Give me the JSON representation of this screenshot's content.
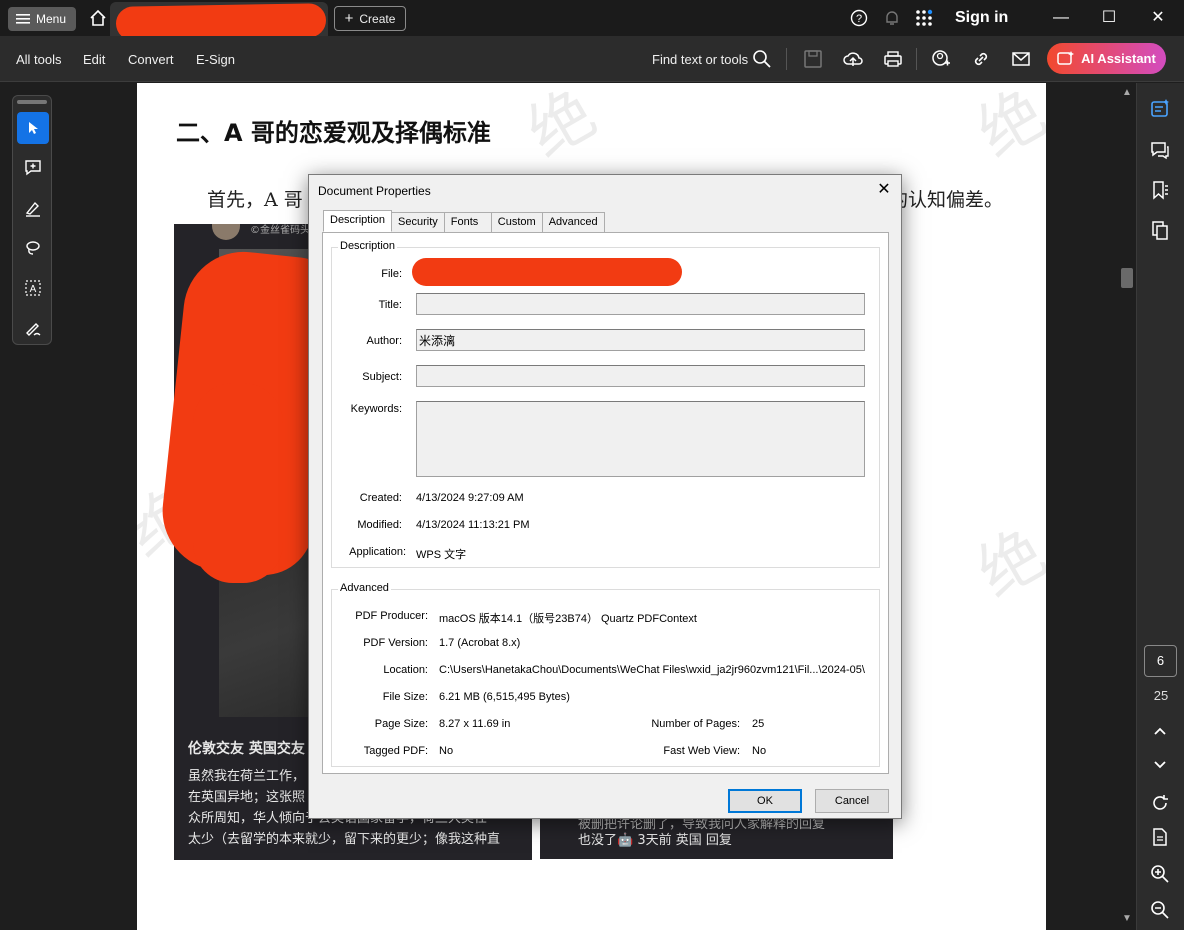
{
  "titlebar": {
    "menu_label": "Menu",
    "create_label": "Create",
    "signin_label": "Sign in"
  },
  "toolbar": {
    "items": [
      "All tools",
      "Edit",
      "Convert",
      "E-Sign"
    ],
    "find_label": "Find text or tools",
    "ai_label": "AI Assistant"
  },
  "page": {
    "heading": "二、A 哥的恋爱观及择偶标准",
    "para_left": "首先，A 哥",
    "para_right": "的认知偏差。",
    "card_left": {
      "title": "伦敦交友 英国交友",
      "lines": [
        "虽然我在荷兰工作，",
        "在英国异地；这张照",
        "众所周知，华人倾向于去英语国家留学，荷兰大奖任",
        "太少（去留学的本来就少，留下来的更少；像我这种直"
      ]
    },
    "card_right": {
      "lines": [
        "被删把许论删了，导致我问人家解释的回复",
        "也没了🤖 3天前 英国 回复"
      ]
    },
    "badge_text": "©金丝雀码头"
  },
  "right_rail": {
    "current_page": "6",
    "total_pages": "25"
  },
  "dialog": {
    "title": "Document Properties",
    "tabs": [
      "Description",
      "Security",
      "Fonts",
      "Custom",
      "Advanced"
    ],
    "description_group": "Description",
    "labels": {
      "file": "File:",
      "title": "Title:",
      "author": "Author:",
      "subject": "Subject:",
      "keywords": "Keywords:",
      "created": "Created:",
      "modified": "Modified:",
      "application": "Application:"
    },
    "values": {
      "title": "",
      "author": "米添漓",
      "subject": "",
      "keywords": "",
      "created": "4/13/2024 9:27:09 AM",
      "modified": "4/13/2024 11:13:21 PM",
      "application": "WPS 文字"
    },
    "advanced_group": "Advanced",
    "advanced_labels": {
      "producer": "PDF Producer:",
      "version": "PDF Version:",
      "location": "Location:",
      "filesize": "File Size:",
      "pagesize": "Page Size:",
      "pages": "Number of Pages:",
      "tagged": "Tagged PDF:",
      "fastweb": "Fast Web View:"
    },
    "advanced_values": {
      "producer": "macOS 版本14.1（版号23B74） Quartz PDFContext",
      "version": "1.7 (Acrobat 8.x)",
      "location": "C:\\Users\\HanetakaChou\\Documents\\WeChat Files\\wxid_ja2jr960zvm121\\Fil...\\2024-05\\",
      "filesize": "6.21 MB (6,515,495 Bytes)",
      "pagesize": "8.27 x 11.69 in",
      "pages": "25",
      "tagged": "No",
      "fastweb": "No"
    },
    "ok_label": "OK",
    "cancel_label": "Cancel"
  },
  "colors": {
    "accent": "#1473e6",
    "redaction": "#f23b12",
    "ai_gradient_start": "#f2492e",
    "ai_gradient_end": "#d34cc0"
  }
}
